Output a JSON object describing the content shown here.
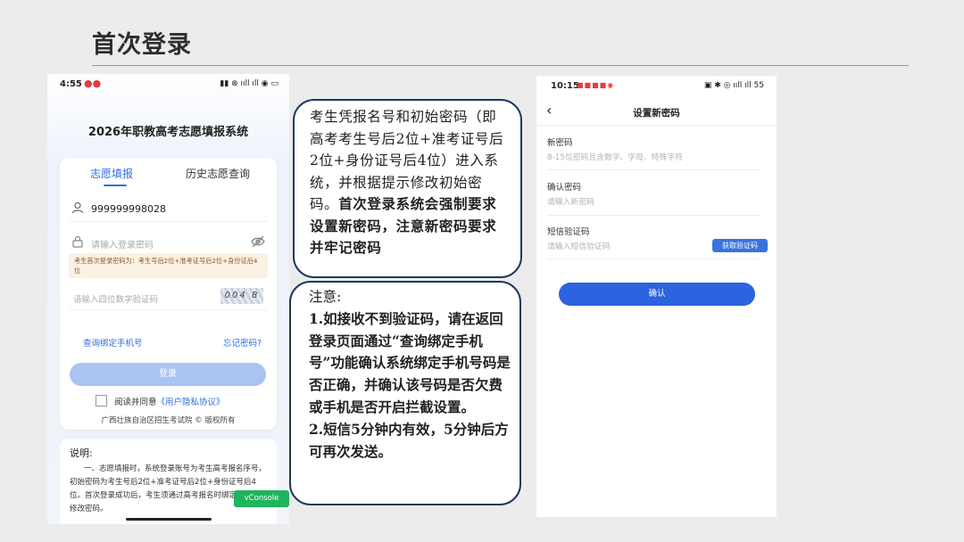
{
  "slide": {
    "title": "首次登录"
  },
  "phone1": {
    "status": {
      "time": "4:55",
      "dots": "●●",
      "indicators": "▮▮ ⊗ ııll ıll ◉ ▭"
    },
    "system_title": "2026年职教高考志愿填报系统",
    "tabs": [
      {
        "label": "志愿填报"
      },
      {
        "label": "历史志愿查询"
      }
    ],
    "account_value": "999999998028",
    "password_placeholder": "请输入登录密码",
    "notice": "考生首次登录密码为：考生号后2位+准考证号后2位+身份证后4位",
    "captcha_placeholder": "请输入四位数字验证码",
    "captcha_text": "004 8",
    "link_query_phone": "查询绑定手机号",
    "link_forgot": "忘记密码?",
    "login_label": "登录",
    "agree_text": "阅读并同意",
    "agree_link": "《用户隐私协议》",
    "footer": "广西壮族自治区招生考试院 © 版权所有",
    "explain_heading": "说明:",
    "explain_body": "一、志愿填报时，系统登录账号为考生高考报名序号，初始密码为考生号后2位+准考证号后2位+身份证号后4位。首次登录成功后，考生须通过高考报名时绑定的手机号修改密码。",
    "vconsole_label": "vConsole"
  },
  "callout1": {
    "normal": "考生凭报名号和初始密码（即高考考生号后2位+准考证号后2位+身份证号后4位）进入系统，并根据提示修改初始密码。",
    "bold": "首次登录系统会强制要求设置新密码，注意新密码要求并牢记密码"
  },
  "callout2": {
    "heading": "注意:",
    "item1": "1.如接收不到验证码，请在返回登录页面通过“查询绑定手机号”功能确认系统绑定手机号码是否正确，并确认该号码是否欠费或手机是否开启拦截设置。",
    "item2": "2.短信5分钟内有效，5分钟后方可再次发送。"
  },
  "phone2": {
    "status": {
      "time": "10:15",
      "apps": "■■■■◉",
      "indicators": "▣ ✱ ◎ ııll ıll 55"
    },
    "back_glyph": "‹",
    "title": "设置新密码",
    "new_pwd_label": "新密码",
    "new_pwd_placeholder": "8-15位密码且含数字、字母、特殊字符",
    "confirm_pwd_label": "确认密码",
    "confirm_pwd_placeholder": "请输入新密码",
    "sms_label": "短信验证码",
    "sms_placeholder": "请输入短信验证码",
    "sms_button": "获取验证码",
    "confirm_button": "确认"
  },
  "colors": {
    "accent": "#2e6de0",
    "callout_border": "#1c3a5e",
    "vconsole": "#1fb35c"
  },
  "icons": [
    "user-icon",
    "lock-icon",
    "eye-off-icon",
    "back-arrow-icon"
  ]
}
